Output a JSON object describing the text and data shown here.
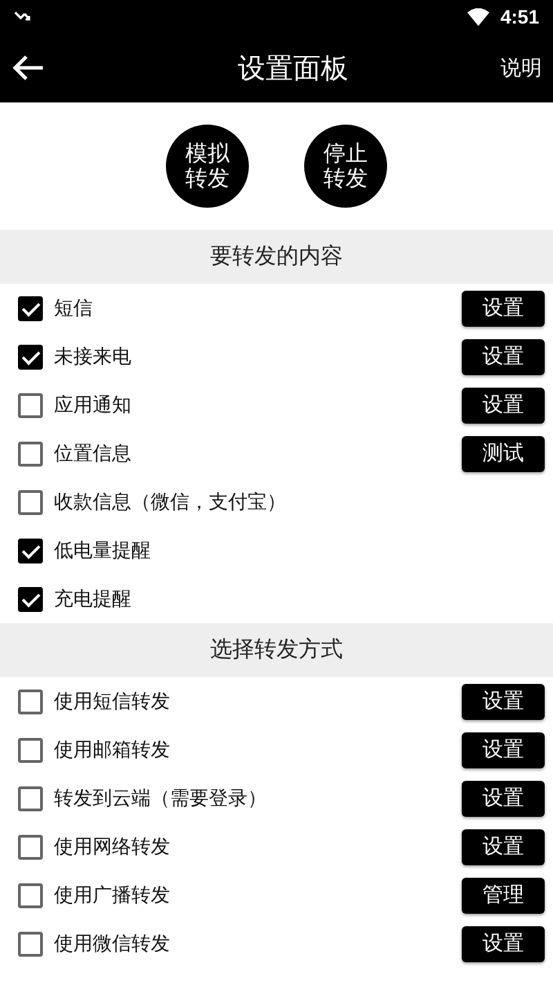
{
  "status_bar": {
    "time": "4:51"
  },
  "app_bar": {
    "title": "设置面板",
    "action": "说明"
  },
  "round_buttons": [
    "模拟转发",
    "停止转发"
  ],
  "sections": [
    {
      "title": "要转发的内容",
      "items": [
        {
          "label": "短信",
          "checked": true,
          "button": "设置"
        },
        {
          "label": "未接来电",
          "checked": true,
          "button": "设置"
        },
        {
          "label": "应用通知",
          "checked": false,
          "button": "设置"
        },
        {
          "label": "位置信息",
          "checked": false,
          "button": "测试"
        },
        {
          "label": "收款信息（微信，支付宝）",
          "checked": false
        },
        {
          "label": "低电量提醒",
          "checked": true
        },
        {
          "label": "充电提醒",
          "checked": true
        }
      ]
    },
    {
      "title": "选择转发方式",
      "items": [
        {
          "label": "使用短信转发",
          "checked": false,
          "button": "设置"
        },
        {
          "label": "使用邮箱转发",
          "checked": false,
          "button": "设置"
        },
        {
          "label": "转发到云端（需要登录）",
          "checked": false,
          "button": "设置"
        },
        {
          "label": "使用网络转发",
          "checked": false,
          "button": "设置"
        },
        {
          "label": "使用广播转发",
          "checked": false,
          "button": "管理"
        },
        {
          "label": "使用微信转发",
          "checked": false,
          "button": "设置"
        }
      ]
    }
  ]
}
